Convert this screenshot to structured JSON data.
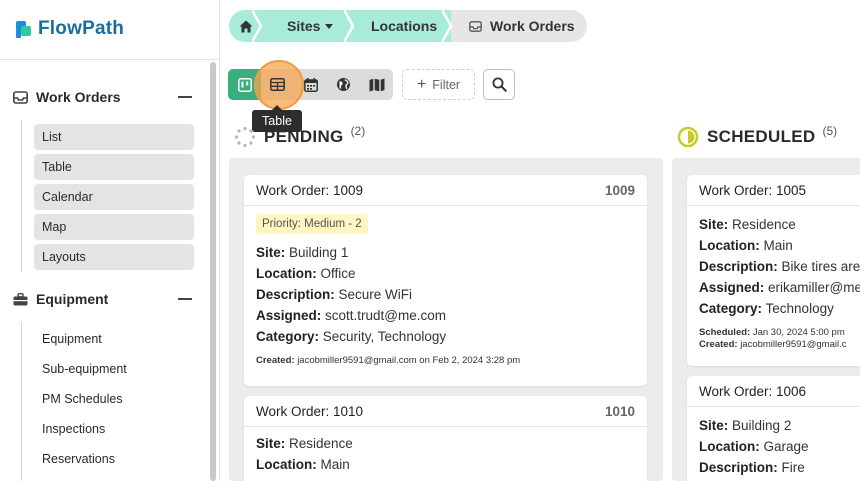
{
  "app": {
    "brand_flow": "Flow",
    "brand_path": "Path"
  },
  "sidebar": {
    "sections": [
      {
        "label": "Work Orders",
        "items": [
          "List",
          "Table",
          "Calendar",
          "Map",
          "Layouts"
        ]
      },
      {
        "label": "Equipment",
        "items": [
          "Equipment",
          "Sub-equipment",
          "PM Schedules",
          "Inspections",
          "Reservations"
        ]
      }
    ]
  },
  "breadcrumb": {
    "sites": "Sites",
    "locations": "Locations",
    "current": "Work Orders"
  },
  "toolbar": {
    "filter_label": "Filter",
    "tooltip": "Table"
  },
  "columns": [
    {
      "title": "PENDING",
      "count": "(2)",
      "cards": [
        {
          "title": "Work Order: 1009",
          "number": "1009",
          "priority": "Priority: Medium - 2",
          "site_label": "Site:",
          "site": "Building 1",
          "location_label": "Location:",
          "location": "Office",
          "description_label": "Description:",
          "description": "Secure WiFi",
          "assigned_label": "Assigned:",
          "assigned": "scott.trudt@me.com",
          "category_label": "Category:",
          "category": "Security, Technology",
          "created_label": "Created:",
          "created": "jacobmiller9591@gmail.com on Feb 2, 2024 3:28 pm"
        },
        {
          "title": "Work Order: 1010",
          "number": "1010",
          "site_label": "Site:",
          "site": "Residence",
          "location_label": "Location:",
          "location": "Main"
        }
      ]
    },
    {
      "title": "SCHEDULED",
      "count": "(5)",
      "cards": [
        {
          "title": "Work Order: 1005",
          "site_label": "Site:",
          "site": "Residence",
          "location_label": "Location:",
          "location": "Main",
          "description_label": "Description:",
          "description": "Bike tires are",
          "assigned_label": "Assigned:",
          "assigned": "erikamiller@me",
          "category_label": "Category:",
          "category": "Technology",
          "scheduled_label": "Scheduled:",
          "scheduled": "Jan 30, 2024 5:00 pm",
          "created_label": "Created:",
          "created": "jacobmiller9591@gmail.c"
        },
        {
          "title": "Work Order: 1006",
          "site_label": "Site:",
          "site": "Building 2",
          "location_label": "Location:",
          "location": "Garage",
          "description_label": "Description:",
          "description": "Fire"
        }
      ]
    }
  ],
  "colors": {
    "accent_green": "#3aae7e",
    "breadcrumb_mint": "#a7ecd9",
    "highlight_orange": "#f19a3e",
    "scheduled_yellow": "#c9c92a"
  }
}
